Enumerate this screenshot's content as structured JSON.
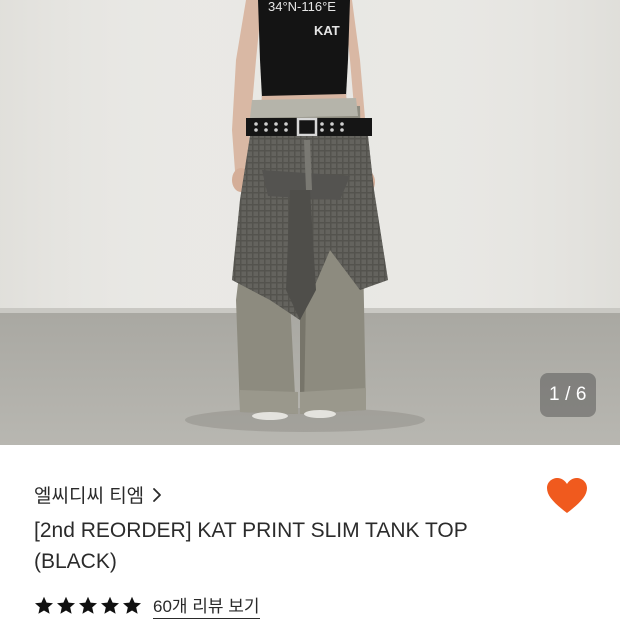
{
  "hero": {
    "shirt_print_line1": "34°N-116°E",
    "shirt_print_line2": "KAT",
    "counter_current": "1",
    "counter_separator": "/",
    "counter_total": "6"
  },
  "product": {
    "brand": "엘씨디씨 티엠",
    "title_line1": "[2nd REORDER] KAT PRINT SLIM TANK TOP",
    "title_line2": "(BLACK)",
    "rating_stars": 5,
    "review_link": "60개 리뷰 보기"
  },
  "colors": {
    "heart": "#f05a1e",
    "text": "#2a2a2a"
  },
  "icons": {
    "brand_chevron": "chevron-right-icon",
    "wishlist": "heart-icon",
    "rating": "star-icon"
  }
}
